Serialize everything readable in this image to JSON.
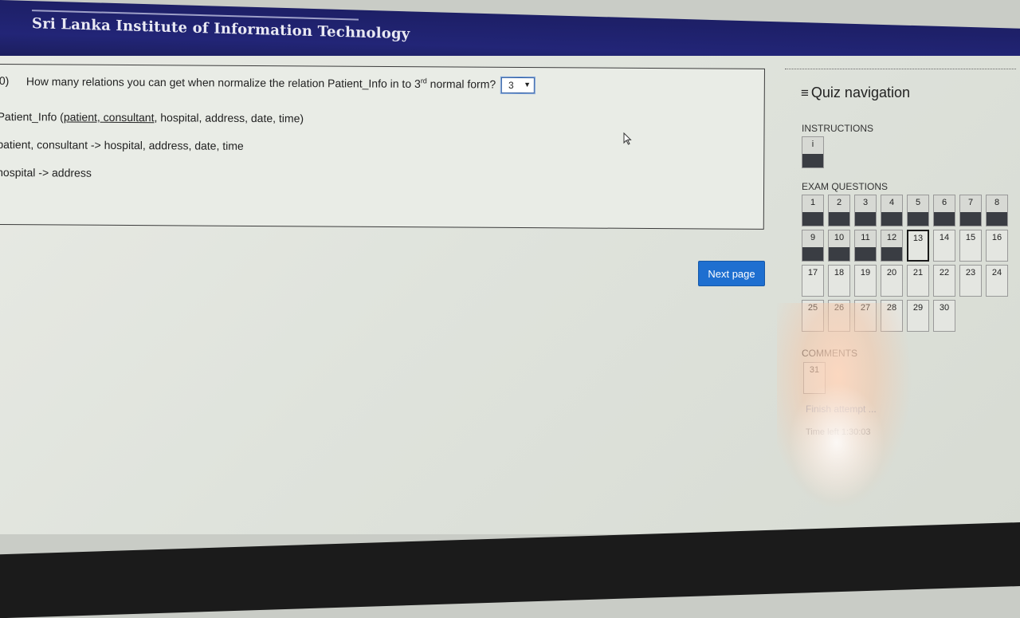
{
  "header": {
    "title": "Sri Lanka Institute of Information Technology"
  },
  "question": {
    "number": "0)",
    "text_before": "How many relations you can get when normalize the relation Patient_Info in to 3",
    "superscript": "rd",
    "text_after": " normal form?",
    "selected_answer": "3",
    "relation_name": "Patient_Info (",
    "relation_keys": "patient, consultant",
    "relation_rest": ", hospital, address, date, time)",
    "fd1": "patient, consultant -> hospital, address, date, time",
    "fd2": "hospital -> address"
  },
  "next_button": "Next page",
  "nav": {
    "title": "Quiz navigation",
    "instructions_label": "INSTRUCTIONS",
    "instructions_item": "i",
    "exam_label": "EXAM QUESTIONS",
    "comments_label": "COMMENTS",
    "comments_item": "31",
    "finish_link": "Finish attempt ...",
    "time_left": "Time left 1:30:03",
    "questions": [
      {
        "n": "1",
        "state": "answered"
      },
      {
        "n": "2",
        "state": "answered"
      },
      {
        "n": "3",
        "state": "answered"
      },
      {
        "n": "4",
        "state": "answered"
      },
      {
        "n": "5",
        "state": "answered"
      },
      {
        "n": "6",
        "state": "answered"
      },
      {
        "n": "7",
        "state": "answered"
      },
      {
        "n": "8",
        "state": "answered"
      },
      {
        "n": "9",
        "state": "answered"
      },
      {
        "n": "10",
        "state": "answered"
      },
      {
        "n": "11",
        "state": "answered"
      },
      {
        "n": "12",
        "state": "answered"
      },
      {
        "n": "13",
        "state": "current"
      },
      {
        "n": "14",
        "state": "unanswered"
      },
      {
        "n": "15",
        "state": "unanswered"
      },
      {
        "n": "16",
        "state": "unanswered"
      },
      {
        "n": "17",
        "state": "unanswered"
      },
      {
        "n": "18",
        "state": "unanswered"
      },
      {
        "n": "19",
        "state": "unanswered"
      },
      {
        "n": "20",
        "state": "unanswered"
      },
      {
        "n": "21",
        "state": "unanswered"
      },
      {
        "n": "22",
        "state": "unanswered"
      },
      {
        "n": "23",
        "state": "unanswered"
      },
      {
        "n": "24",
        "state": "unanswered"
      },
      {
        "n": "25",
        "state": "unanswered"
      },
      {
        "n": "26",
        "state": "unanswered"
      },
      {
        "n": "27",
        "state": "unanswered"
      },
      {
        "n": "28",
        "state": "unanswered"
      },
      {
        "n": "29",
        "state": "unanswered"
      },
      {
        "n": "30",
        "state": "unanswered"
      }
    ]
  },
  "colors": {
    "header_bg": "#222577",
    "header_border": "#c0392b",
    "button": "#1e6fd0",
    "answered_band": "#3a3d43"
  }
}
